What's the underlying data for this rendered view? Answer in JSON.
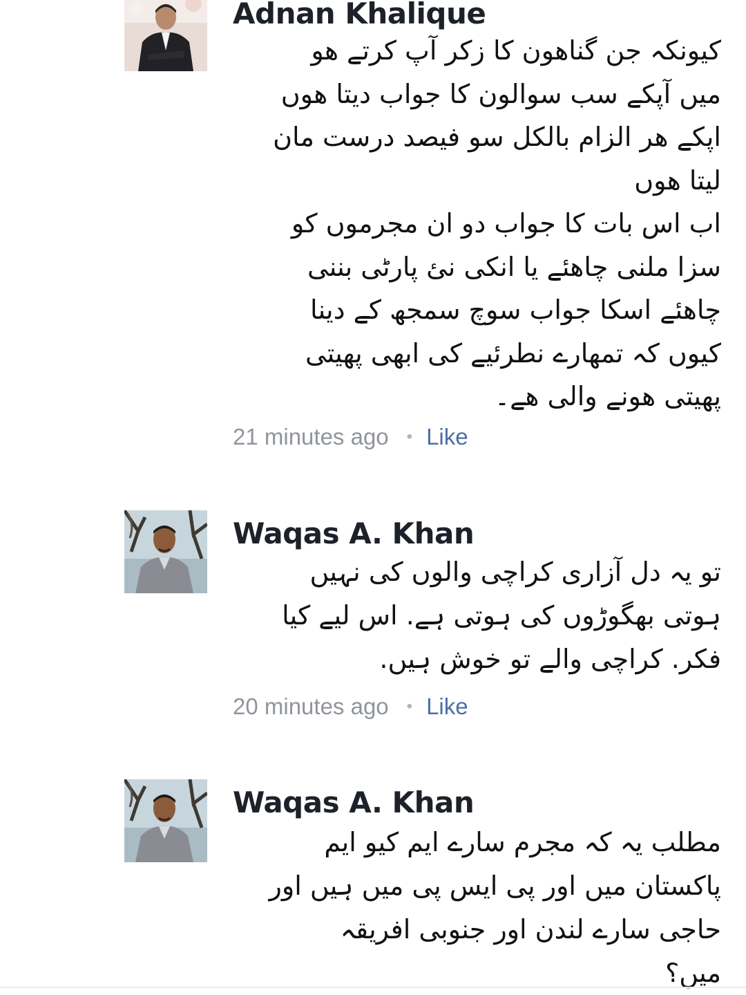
{
  "comments": [
    {
      "author": "Adnan Khalique",
      "avatar_icon": "profile-photo",
      "text": "کیونکہ جن گناھون کا زکر آپ کرتے ھو\nمیں آپکے سب سوالون کا جواب دیتا ھوں\nاپکے ھر الزام بالکل سو فیصد درست مان\nلیتا ھوں\nاب اس بات کا جواب دو ان مجرموں کو\nسزا ملنی چاھئے یا انکی نئ پارٹی بننی\nچاھئے اسکا جواب سوچ سمجھ کے دینا\nکیوں کہ تمھارے نطرئیے کی ابھی پھیتی\nپھیتی ھونے والی ھے۔",
      "time": "21 minutes ago",
      "separator": "•",
      "like_label": "Like"
    },
    {
      "author": "Waqas A. Khan",
      "avatar_icon": "profile-photo",
      "text": "تو یہ دل آزاری کراچی والوں کی نہیں\nہوتی بھگوڑوں کی ہوتی ہے. اس لیے کیا\nفکر. کراچی والے تو خوش ہیں.",
      "time": "20 minutes ago",
      "separator": "•",
      "like_label": "Like"
    },
    {
      "author": "Waqas A. Khan",
      "avatar_icon": "profile-photo",
      "text": "مطلب یہ کہ مجرم سارے ایم کیو ایم\nپاکستان میں اور پی ایس پی میں ہیں اور\nحاجی سارے لندن اور جنوبی افریقہ\nمیں؟",
      "time": "",
      "separator": "",
      "like_label": ""
    }
  ]
}
